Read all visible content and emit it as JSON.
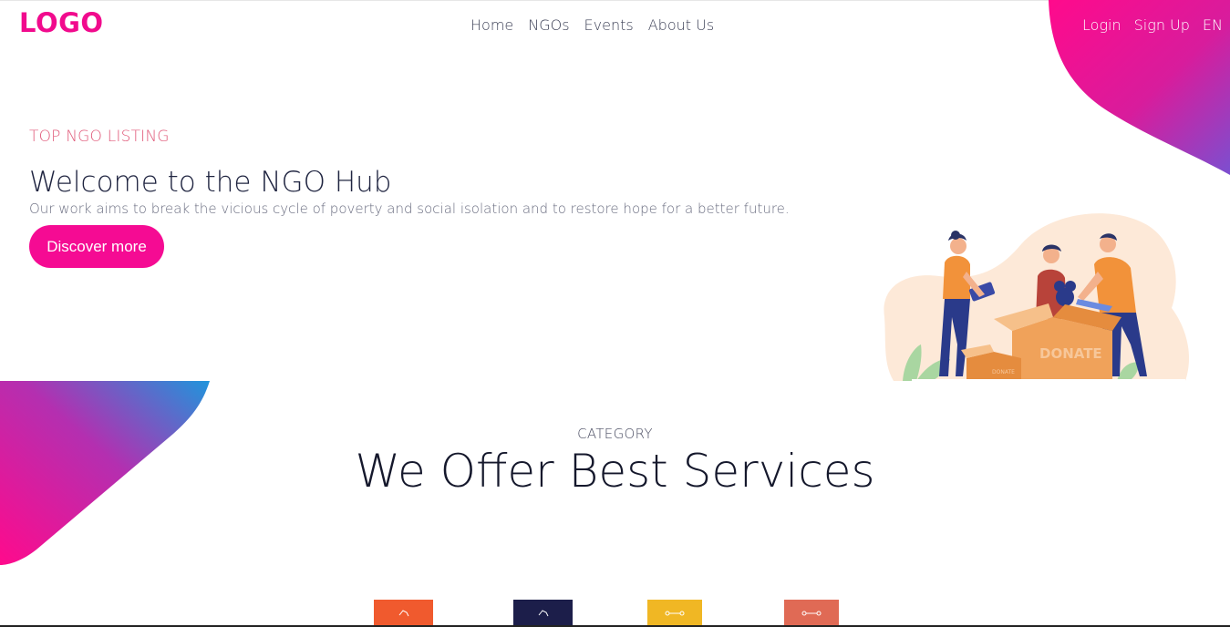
{
  "header": {
    "logo": "LOGO",
    "nav": [
      "Home",
      "NGOs",
      "Events",
      "About Us"
    ],
    "auth": {
      "login": "Login",
      "signup": "Sign Up",
      "lang": "EN"
    }
  },
  "hero": {
    "eyebrow": "TOP NGO LISTING",
    "title": "Welcome to the NGO Hub",
    "subtitle": "Our work aims to break the vicious cycle of poverty and social isolation and to restore hope for a better future.",
    "cta": "Discover more",
    "illustration_box_label": "DONATE",
    "illustration_small_box_label": "DONATE"
  },
  "services": {
    "category": "CATEGORY",
    "title": "We Offer Best Services",
    "cards": [
      {
        "icon": "hand-icon",
        "color": "#f05a2e"
      },
      {
        "icon": "hand-icon",
        "color": "#1c1e4a"
      },
      {
        "icon": "link-icon",
        "color": "#f0b724"
      },
      {
        "icon": "link-icon",
        "color": "#e06a55"
      }
    ]
  },
  "colors": {
    "accent": "#f50b93",
    "gradient_end": "#7b4fd0",
    "gradient_blue": "#1f95dc"
  }
}
